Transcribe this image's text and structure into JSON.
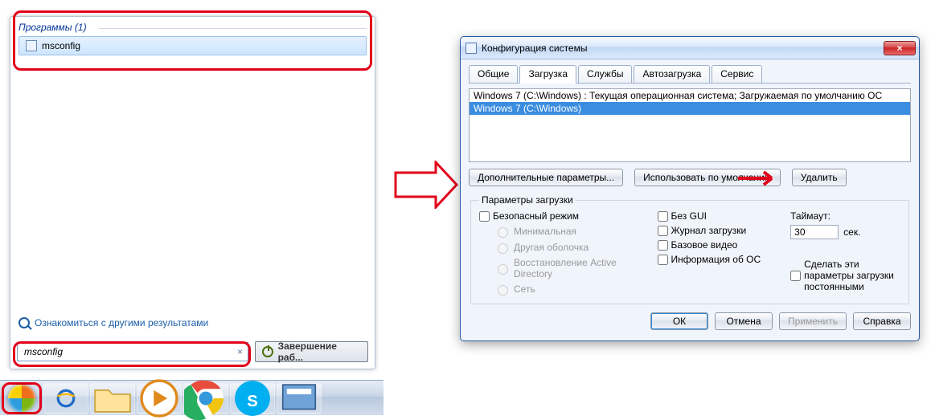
{
  "startmenu": {
    "programs_header": "Программы (1)",
    "result_item": "msconfig",
    "other_results": "Ознакомиться с другими результатами",
    "search_value": "msconfig",
    "shutdown_label": "Завершение раб..."
  },
  "taskbar": {
    "start": "Пуск"
  },
  "dialog": {
    "title": "Конфигурация системы",
    "tabs": [
      "Общие",
      "Загрузка",
      "Службы",
      "Автозагрузка",
      "Сервис"
    ],
    "boot_entries": [
      "Windows 7 (C:\\Windows) : Текущая операционная система; Загружаемая по умолчанию ОС",
      "Windows 7 (C:\\Windows)"
    ],
    "btn_advanced": "Дополнительные параметры...",
    "btn_default": "Использовать по умолчанию",
    "btn_delete": "Удалить",
    "boot_options_legend": "Параметры загрузки",
    "safe_mode": "Безопасный режим",
    "r_minimal": "Минимальная",
    "r_altshell": "Другая оболочка",
    "r_adrestore": "Восстановление Active Directory",
    "r_network": "Сеть",
    "no_gui": "Без GUI",
    "boot_log": "Журнал загрузки",
    "base_video": "Базовое видео",
    "os_info": "Информация  об ОС",
    "timeout_label": "Таймаут:",
    "timeout_value": "30",
    "timeout_unit": "сек.",
    "persist": "Сделать эти параметры загрузки постоянными",
    "footer": {
      "ok": "ОК",
      "cancel": "Отмена",
      "apply": "Применить",
      "help": "Справка"
    }
  }
}
